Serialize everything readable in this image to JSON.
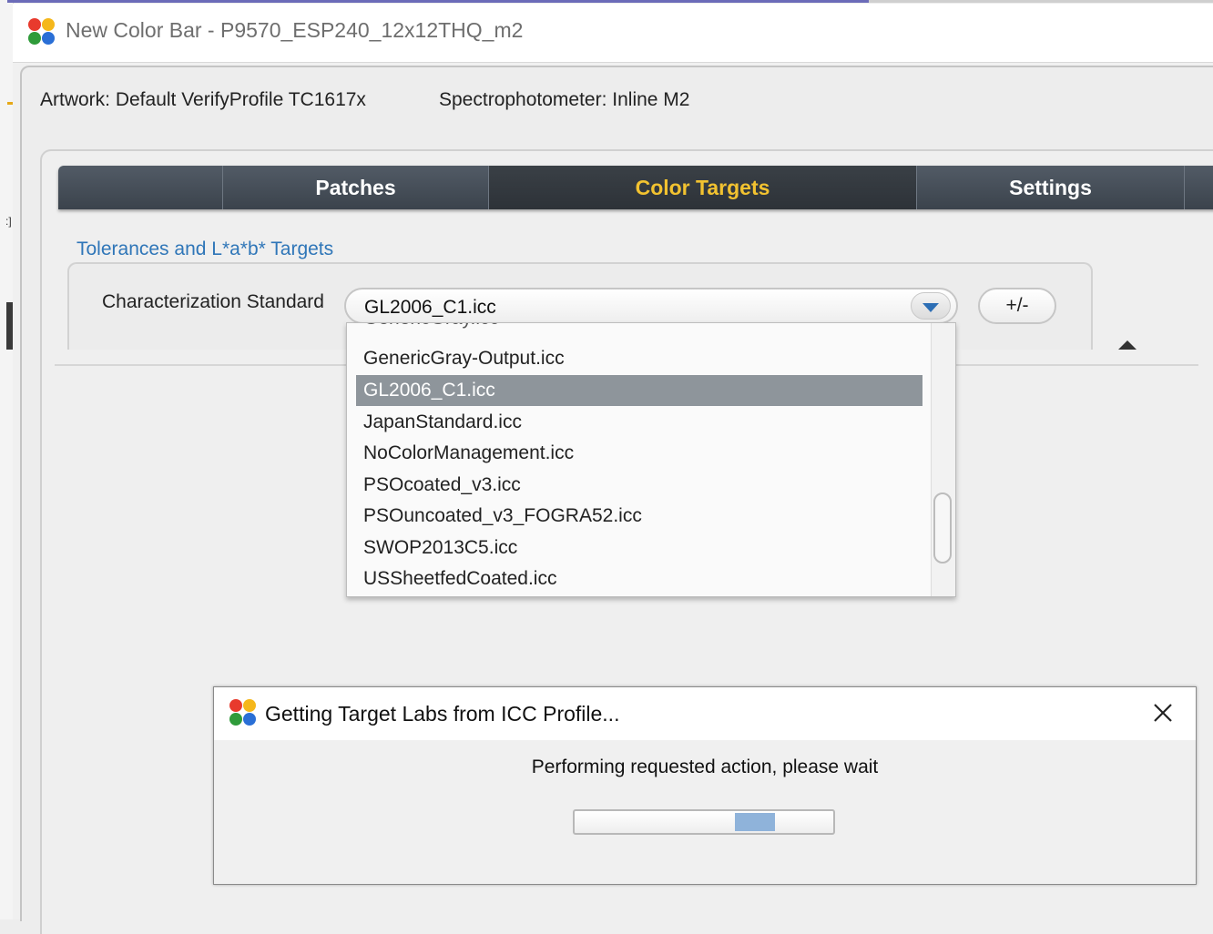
{
  "window": {
    "title": "New Color Bar - P9570_ESP240_12x12THQ_m2",
    "artwork": "Artwork: Default VerifyProfile TC1617x",
    "spectrophotometer": "Spectrophotometer: Inline M2"
  },
  "tabs": [
    {
      "label": "Patches",
      "active": false
    },
    {
      "label": "Color Targets",
      "active": true
    },
    {
      "label": "Settings",
      "active": false
    }
  ],
  "tolerances": {
    "group_label": "Tolerances and L*a*b* Targets",
    "characterization_label": "Characterization Standard",
    "selected_profile": "GL2006_C1.icc",
    "plus_minus_label": "+/-"
  },
  "dropdown": {
    "items": [
      "GenericGray-Output.icc",
      "GL2006_C1.icc",
      "JapanStandard.icc",
      "NoColorManagement.icc",
      "PSOcoated_v3.icc",
      "PSOuncoated_v3_FOGRA52.icc",
      "SWOP2013C5.icc",
      "USSheetfedCoated.icc"
    ],
    "selected_index": 1
  },
  "dialog": {
    "title": "Getting Target Labs from ICC Profile...",
    "message": "Performing requested action, please wait",
    "close_icon": "close-icon"
  },
  "colors": {
    "tab_active_text": "#f2c230",
    "link_blue": "#2f76b8",
    "selection_gray": "#8e959b",
    "progress_fill": "#8fb3da"
  }
}
